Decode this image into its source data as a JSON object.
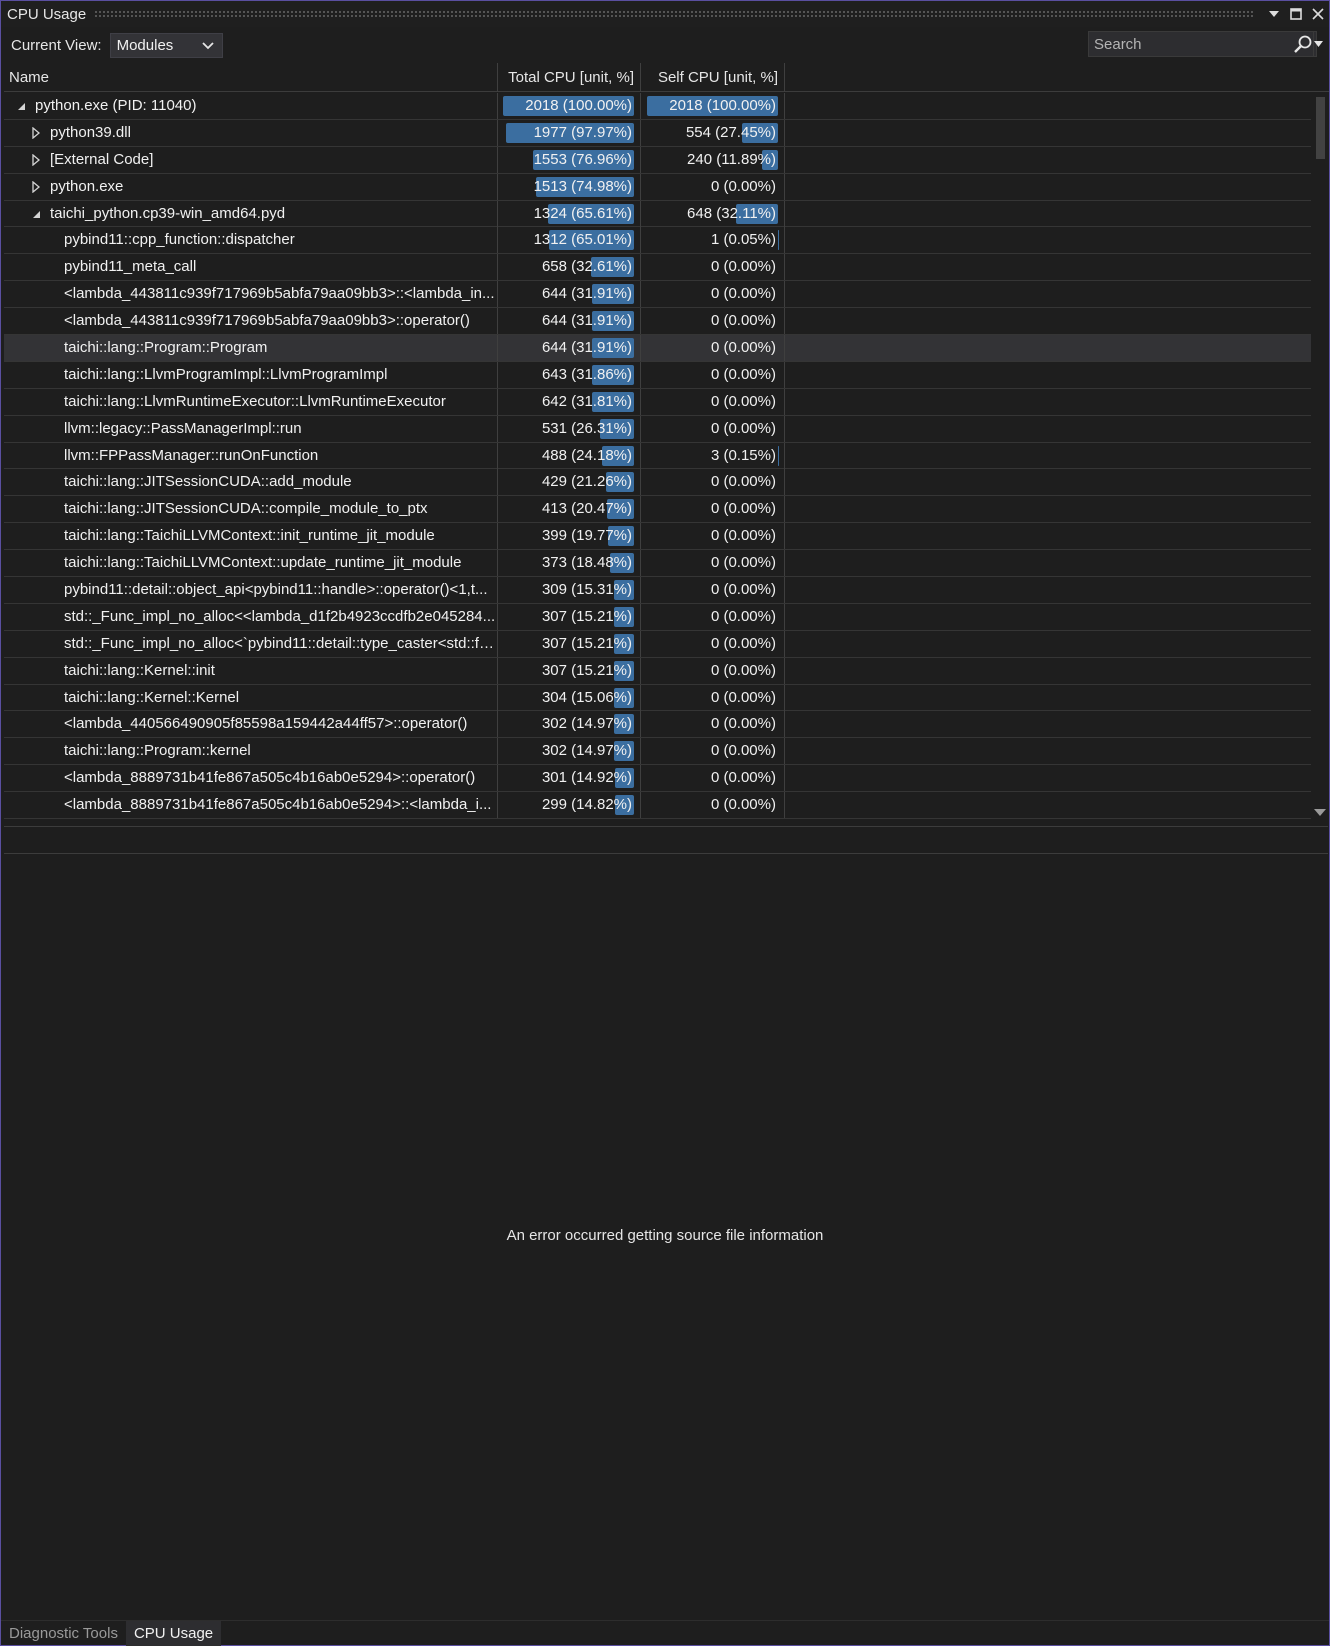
{
  "window": {
    "title": "CPU Usage"
  },
  "toolbar": {
    "current_view_label": "Current View:",
    "current_view_value": "Modules",
    "search_placeholder": "Search"
  },
  "table": {
    "columns": {
      "name": "Name",
      "total": "Total CPU [unit, %]",
      "self": "Self CPU [unit, %]"
    },
    "sorted_column": "total",
    "rows": [
      {
        "name": "python.exe (PID: 11040)",
        "depth": 0,
        "expander": "open",
        "total": "2018 (100.00%)",
        "total_pct": 100.0,
        "self": "2018 (100.00%)",
        "self_pct": 100.0
      },
      {
        "name": "python39.dll",
        "depth": 1,
        "expander": "closed",
        "total": "1977 (97.97%)",
        "total_pct": 97.97,
        "self": "554 (27.45%)",
        "self_pct": 27.45
      },
      {
        "name": "[External Code]",
        "depth": 1,
        "expander": "closed",
        "total": "1553 (76.96%)",
        "total_pct": 76.96,
        "self": "240 (11.89%)",
        "self_pct": 11.89
      },
      {
        "name": "python.exe",
        "depth": 1,
        "expander": "closed",
        "total": "1513 (74.98%)",
        "total_pct": 74.98,
        "self": "0 (0.00%)",
        "self_pct": 0
      },
      {
        "name": "taichi_python.cp39-win_amd64.pyd",
        "depth": 1,
        "expander": "open",
        "total": "1324 (65.61%)",
        "total_pct": 65.61,
        "self": "648 (32.11%)",
        "self_pct": 32.11
      },
      {
        "name": "pybind11::cpp_function::dispatcher",
        "depth": 2,
        "expander": "none",
        "total": "1312 (65.01%)",
        "total_pct": 65.01,
        "self": "1 (0.05%)",
        "self_pct": 0.05
      },
      {
        "name": "pybind11_meta_call",
        "depth": 2,
        "expander": "none",
        "total": "658 (32.61%)",
        "total_pct": 32.61,
        "self": "0 (0.00%)",
        "self_pct": 0
      },
      {
        "name": "<lambda_443811c939f717969b5abfa79aa09bb3>::<lambda_in...",
        "depth": 2,
        "expander": "none",
        "total": "644 (31.91%)",
        "total_pct": 31.91,
        "self": "0 (0.00%)",
        "self_pct": 0
      },
      {
        "name": "<lambda_443811c939f717969b5abfa79aa09bb3>::operator()",
        "depth": 2,
        "expander": "none",
        "total": "644 (31.91%)",
        "total_pct": 31.91,
        "self": "0 (0.00%)",
        "self_pct": 0
      },
      {
        "name": "taichi::lang::Program::Program",
        "depth": 2,
        "expander": "none",
        "total": "644 (31.91%)",
        "total_pct": 31.91,
        "self": "0 (0.00%)",
        "self_pct": 0,
        "selected": true
      },
      {
        "name": "taichi::lang::LlvmProgramImpl::LlvmProgramImpl",
        "depth": 2,
        "expander": "none",
        "total": "643 (31.86%)",
        "total_pct": 31.86,
        "self": "0 (0.00%)",
        "self_pct": 0
      },
      {
        "name": "taichi::lang::LlvmRuntimeExecutor::LlvmRuntimeExecutor",
        "depth": 2,
        "expander": "none",
        "total": "642 (31.81%)",
        "total_pct": 31.81,
        "self": "0 (0.00%)",
        "self_pct": 0
      },
      {
        "name": "llvm::legacy::PassManagerImpl::run",
        "depth": 2,
        "expander": "none",
        "total": "531 (26.31%)",
        "total_pct": 26.31,
        "self": "0 (0.00%)",
        "self_pct": 0
      },
      {
        "name": "llvm::FPPassManager::runOnFunction",
        "depth": 2,
        "expander": "none",
        "total": "488 (24.18%)",
        "total_pct": 24.18,
        "self": "3 (0.15%)",
        "self_pct": 0.15
      },
      {
        "name": "taichi::lang::JITSessionCUDA::add_module",
        "depth": 2,
        "expander": "none",
        "total": "429 (21.26%)",
        "total_pct": 21.26,
        "self": "0 (0.00%)",
        "self_pct": 0
      },
      {
        "name": "taichi::lang::JITSessionCUDA::compile_module_to_ptx",
        "depth": 2,
        "expander": "none",
        "total": "413 (20.47%)",
        "total_pct": 20.47,
        "self": "0 (0.00%)",
        "self_pct": 0
      },
      {
        "name": "taichi::lang::TaichiLLVMContext::init_runtime_jit_module",
        "depth": 2,
        "expander": "none",
        "total": "399 (19.77%)",
        "total_pct": 19.77,
        "self": "0 (0.00%)",
        "self_pct": 0
      },
      {
        "name": "taichi::lang::TaichiLLVMContext::update_runtime_jit_module",
        "depth": 2,
        "expander": "none",
        "total": "373 (18.48%)",
        "total_pct": 18.48,
        "self": "0 (0.00%)",
        "self_pct": 0
      },
      {
        "name": "pybind11::detail::object_api<pybind11::handle>::operator()<1,t...",
        "depth": 2,
        "expander": "none",
        "total": "309 (15.31%)",
        "total_pct": 15.31,
        "self": "0 (0.00%)",
        "self_pct": 0
      },
      {
        "name": "std::_Func_impl_no_alloc<<lambda_d1f2b4923ccdfb2e045284...",
        "depth": 2,
        "expander": "none",
        "total": "307 (15.21%)",
        "total_pct": 15.21,
        "self": "0 (0.00%)",
        "self_pct": 0
      },
      {
        "name": "std::_Func_impl_no_alloc<`pybind11::detail::type_caster<std::fu...",
        "depth": 2,
        "expander": "none",
        "total": "307 (15.21%)",
        "total_pct": 15.21,
        "self": "0 (0.00%)",
        "self_pct": 0
      },
      {
        "name": "taichi::lang::Kernel::init",
        "depth": 2,
        "expander": "none",
        "total": "307 (15.21%)",
        "total_pct": 15.21,
        "self": "0 (0.00%)",
        "self_pct": 0
      },
      {
        "name": "taichi::lang::Kernel::Kernel",
        "depth": 2,
        "expander": "none",
        "total": "304 (15.06%)",
        "total_pct": 15.06,
        "self": "0 (0.00%)",
        "self_pct": 0
      },
      {
        "name": "<lambda_440566490905f85598a159442a44ff57>::operator()",
        "depth": 2,
        "expander": "none",
        "total": "302 (14.97%)",
        "total_pct": 14.97,
        "self": "0 (0.00%)",
        "self_pct": 0
      },
      {
        "name": "taichi::lang::Program::kernel",
        "depth": 2,
        "expander": "none",
        "total": "302 (14.97%)",
        "total_pct": 14.97,
        "self": "0 (0.00%)",
        "self_pct": 0
      },
      {
        "name": "<lambda_8889731b41fe867a505c4b16ab0e5294>::operator()",
        "depth": 2,
        "expander": "none",
        "total": "301 (14.92%)",
        "total_pct": 14.92,
        "self": "0 (0.00%)",
        "self_pct": 0
      },
      {
        "name": "<lambda_8889731b41fe867a505c4b16ab0e5294>::<lambda_i...",
        "depth": 2,
        "expander": "none",
        "total": "299 (14.82%)",
        "total_pct": 14.82,
        "self": "0 (0.00%)",
        "self_pct": 0
      }
    ]
  },
  "source_panel": {
    "message": "An error occurred getting source file information"
  },
  "tabs": [
    {
      "label": "Diagnostic Tools",
      "active": false
    },
    {
      "label": "CPU Usage",
      "active": true
    }
  ],
  "colors": {
    "bar": "#3b6ea0",
    "background": "#1e1e1e",
    "frame_border": "#5a4fa0"
  },
  "icons": [
    "dropdown-arrow-icon",
    "maximize-icon",
    "close-icon",
    "chevron-down-icon",
    "search-icon",
    "expand-icon",
    "collapse-icon",
    "sort-descending-icon"
  ]
}
